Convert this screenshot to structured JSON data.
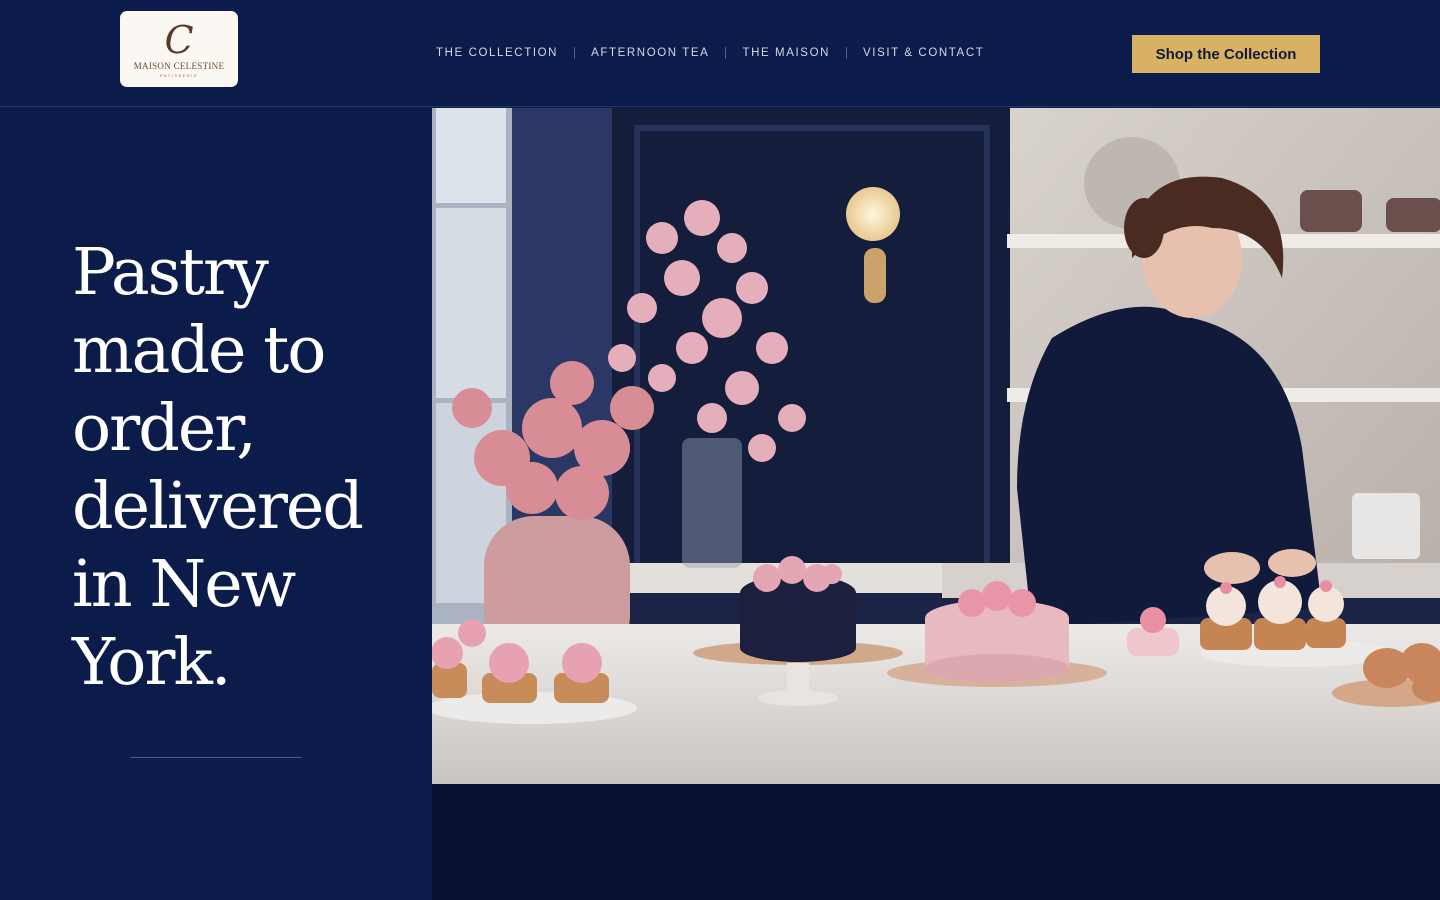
{
  "brand": {
    "logo_monogram": "C",
    "logo_name": "MAISON CELESTINE",
    "logo_tagline": "PATISSERIE"
  },
  "nav": {
    "items": [
      {
        "label": "THE COLLECTION"
      },
      {
        "label": "AFTERNOON TEA"
      },
      {
        "label": "THE MAISON"
      },
      {
        "label": "VISIT & CONTACT"
      }
    ]
  },
  "cta": {
    "label": "Shop the Collection"
  },
  "hero": {
    "headline": "Pastry made to order, delivered in New York.",
    "image_alt": "Pastry chef decorating cakes in a kitchen with pink flowers"
  },
  "colors": {
    "navy": "#0b1c4b",
    "gold": "#d8b163",
    "cream": "#fbf8f3"
  }
}
